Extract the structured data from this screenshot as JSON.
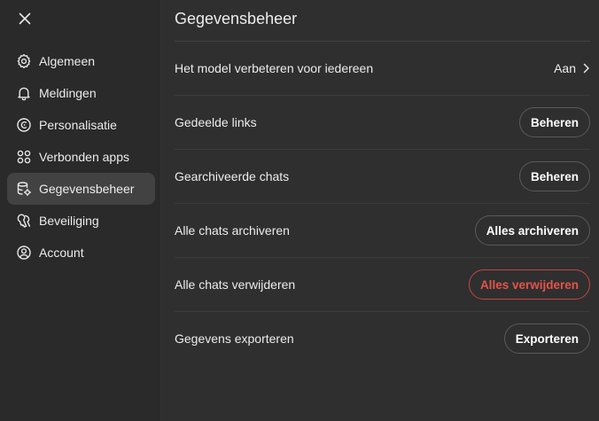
{
  "sidebar": {
    "items": [
      {
        "key": "algemeen",
        "label": "Algemeen",
        "icon": "gear-icon"
      },
      {
        "key": "meldingen",
        "label": "Meldingen",
        "icon": "bell-icon"
      },
      {
        "key": "personalisatie",
        "label": "Personalisatie",
        "icon": "personalization-icon"
      },
      {
        "key": "verbonden-apps",
        "label": "Verbonden apps",
        "icon": "apps-grid-icon"
      },
      {
        "key": "gegevensbeheer",
        "label": "Gegevensbeheer",
        "icon": "database-gear-icon",
        "active": true
      },
      {
        "key": "beveiliging",
        "label": "Beveiliging",
        "icon": "shield-key-icon"
      },
      {
        "key": "account",
        "label": "Account",
        "icon": "user-circle-icon"
      }
    ]
  },
  "main": {
    "title": "Gegevensbeheer",
    "rows": [
      {
        "label": "Het model verbeteren voor iedereen",
        "value": "Aan"
      },
      {
        "label": "Gedeelde links",
        "button": "Beheren"
      },
      {
        "label": "Gearchiveerde chats",
        "button": "Beheren"
      },
      {
        "label": "Alle chats archiveren",
        "button": "Alles archiveren"
      },
      {
        "label": "Alle chats verwijderen",
        "button": "Alles verwijderen"
      },
      {
        "label": "Gegevens exporteren",
        "button": "Exporteren"
      }
    ]
  },
  "colors": {
    "background": "#2f2f2f",
    "sidebar": "#2a2a2a",
    "active_item": "#424242",
    "danger": "#e5534b"
  }
}
